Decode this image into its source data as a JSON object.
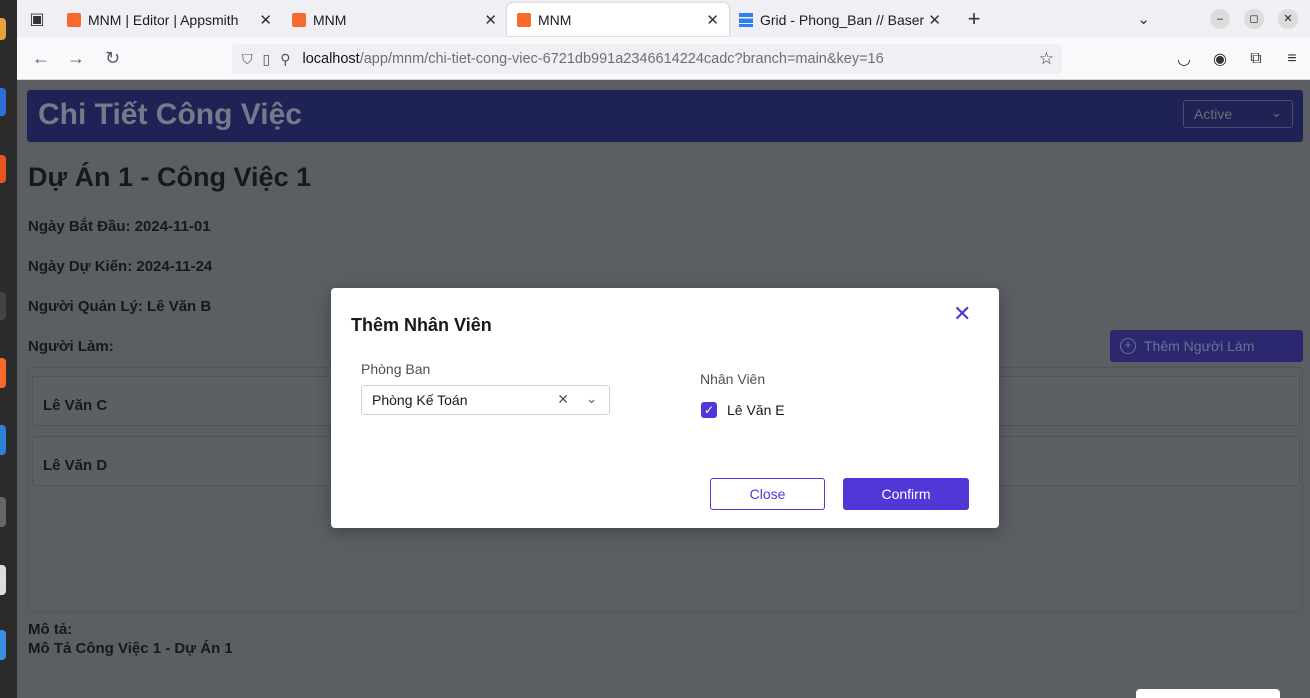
{
  "browser": {
    "tabs": [
      {
        "title": "MNM | Editor | Appsmith",
        "favicon": "appsmith-icon",
        "active": false
      },
      {
        "title": "MNM",
        "favicon": "appsmith-icon",
        "active": false
      },
      {
        "title": "MNM",
        "favicon": "appsmith-icon",
        "active": true
      },
      {
        "title": "Grid - Phong_Ban // Baser",
        "favicon": "grid-icon",
        "active": false
      }
    ],
    "new_tab": "+",
    "url_host": "localhost",
    "url_path": "/app/mnm/chi-tiet-cong-viec-6721db991a2346614224cadc?branch=main&key=16"
  },
  "app": {
    "header_title": "Chi Tiết Công Việc",
    "status_value": "Active",
    "project_title": "Dự Án 1 - Công Việc 1",
    "start_date": "Ngày Bắt Đầu: 2024-11-01",
    "expected_date": "Ngày Dự Kiến:  2024-11-24",
    "manager": "Người Quản Lý: Lê Văn B",
    "workers_label": "Người Làm:",
    "add_worker_label": "Thêm Người Làm",
    "workers": [
      "Lê Văn C",
      "Lê Văn D"
    ],
    "description_label": "Mô tả:",
    "description_text": "Mô Tả Công Việc 1 - Dự Án 1"
  },
  "modal": {
    "title": "Thêm Nhân Viên",
    "department_label": "Phòng Ban",
    "department_value": "Phòng Kế Toán",
    "employee_label": "Nhân Viên",
    "employee_option": "Lê Văn E",
    "employee_checked": true,
    "close_label": "Close",
    "confirm_label": "Confirm"
  },
  "colors": {
    "accent": "#5137d6",
    "header_bg": "#1f2255",
    "overlay": "#5b5f64"
  }
}
